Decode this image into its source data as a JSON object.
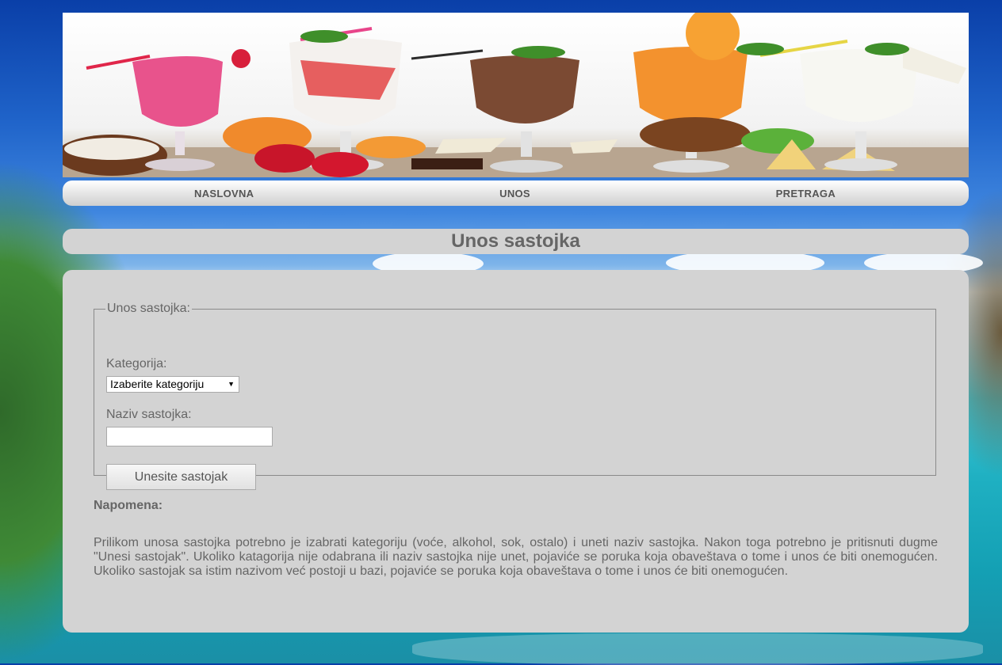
{
  "nav": {
    "items": [
      {
        "label": "NASLOVNA"
      },
      {
        "label": "UNOS"
      },
      {
        "label": "PRETRAGA"
      }
    ]
  },
  "page": {
    "title": "Unos sastojka"
  },
  "form": {
    "legend": "Unos sastojka:",
    "category_label": "Kategorija:",
    "category_selected": "Izaberite kategoriju",
    "name_label": "Naziv sastojka:",
    "name_value": "",
    "submit_label": "Unesite sastojak"
  },
  "note": {
    "title": "Napomena:",
    "text": "Prilikom unosa sastojka potrebno je izabrati kategoriju (voće, alkohol, sok, ostalo) i uneti naziv sastojka. Nakon toga potrebno je pritisnuti dugme \"Unesi sastojak\". Ukoliko katagorija nije odabrana ili naziv sastojka nije unet, pojaviće se poruka koja obaveštava o tome i unos će biti onemogućen. Ukoliko sastojak sa istim nazivom već postoji u bazi, pojaviće se poruka koja obaveštava o tome i unos će biti onemogućen."
  },
  "icons": {
    "select_arrow": "dropdown-arrow-icon"
  }
}
